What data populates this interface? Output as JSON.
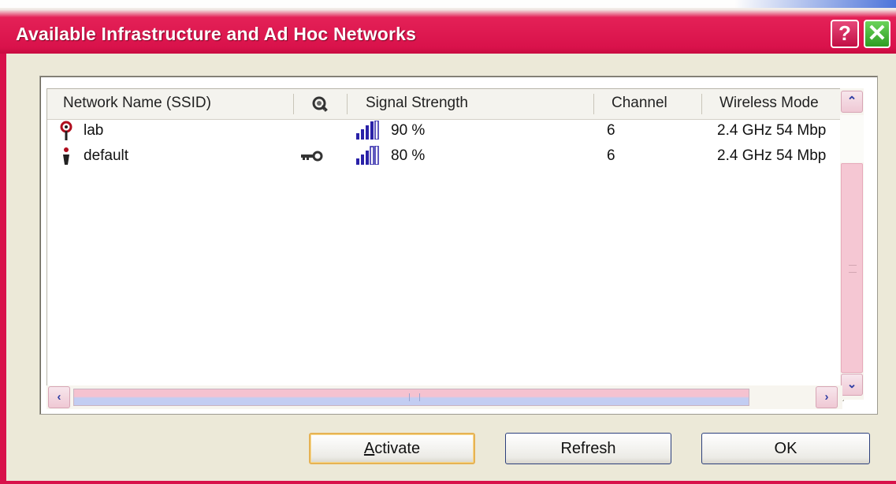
{
  "window": {
    "title": "Available Infrastructure and Ad Hoc Networks",
    "help_label": "?",
    "close_label": "✕"
  },
  "list": {
    "columns": [
      "Network Name (SSID)",
      "",
      "Signal Strength",
      "Channel",
      "Wireless Mode"
    ],
    "rows": [
      {
        "type": "infrastructure",
        "name": "lab",
        "secured": false,
        "signal": "90 %",
        "channel": "6",
        "mode": "2.4 GHz 54 Mbp"
      },
      {
        "type": "adhoc",
        "name": "default",
        "secured": true,
        "signal": "80 %",
        "channel": "6",
        "mode": "2.4 GHz 54 Mbp"
      }
    ]
  },
  "scrollbars": {
    "up": "⌃",
    "down": "⌄",
    "left": "‹",
    "right": "›"
  },
  "buttons": {
    "activate_mnemonic": "A",
    "activate_rest": "ctivate",
    "refresh": "Refresh",
    "ok": "OK"
  },
  "colors": {
    "accent": "#d8114a",
    "default_button_border": "#e6b253"
  },
  "icons": {
    "header_security": "key-lock-icon",
    "row_infrastructure": "access-point-icon",
    "row_adhoc": "adhoc-station-icon",
    "row_secured": "key-icon",
    "row_signal": "signal-bars-icon"
  }
}
